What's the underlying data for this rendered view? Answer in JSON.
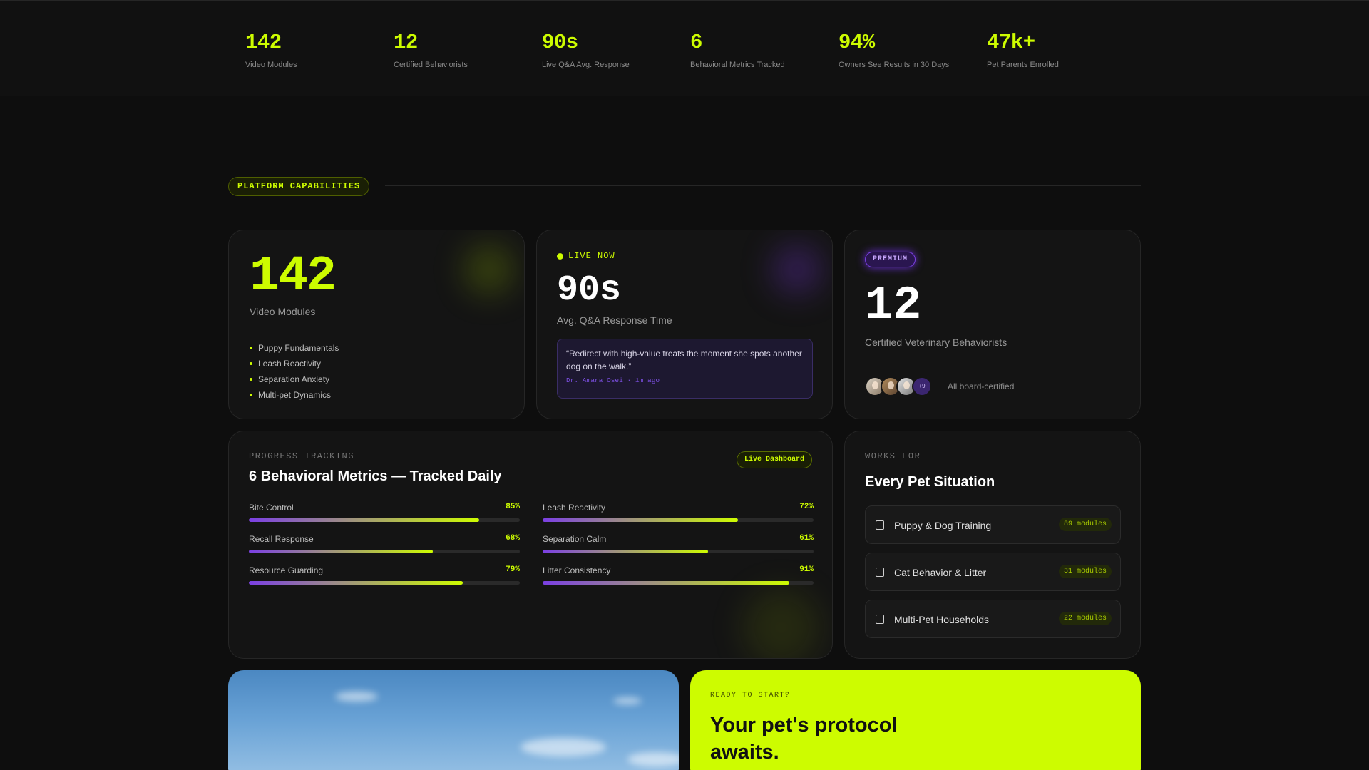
{
  "stats": [
    {
      "value": "142",
      "label": "Video Modules"
    },
    {
      "value": "12",
      "label": "Certified Behaviorists"
    },
    {
      "value": "90s",
      "label": "Live Q&A Avg. Response"
    },
    {
      "value": "6",
      "label": "Behavioral Metrics Tracked"
    },
    {
      "value": "94%",
      "label": "Owners See Results in 30 Days"
    },
    {
      "value": "47k+",
      "label": "Pet Parents Enrolled"
    }
  ],
  "section": {
    "tag": "PLATFORM CAPABILITIES"
  },
  "modules_card": {
    "number": "142",
    "label": "Video Modules",
    "items": [
      "Puppy Fundamentals",
      "Leash Reactivity",
      "Separation Anxiety",
      "Multi-pet Dynamics"
    ]
  },
  "qa_card": {
    "live": "LIVE NOW",
    "number": "90s",
    "label": "Avg. Q&A Response Time",
    "quote": "“Redirect with high-value treats the moment she spots another dog on the walk.”",
    "attribution": "Dr. Amara Osei · 1m ago"
  },
  "vets_card": {
    "badge": "PREMIUM",
    "number": "12",
    "label": "Certified Veterinary Behaviorists",
    "more_count": "+9",
    "note": "All board-certified"
  },
  "progress_card": {
    "kicker": "PROGRESS TRACKING",
    "title": "6 Behavioral Metrics — Tracked Daily",
    "badge": "Live Dashboard",
    "metrics": [
      {
        "name": "Bite Control",
        "pct_label": "85%",
        "value": 85
      },
      {
        "name": "Leash Reactivity",
        "pct_label": "72%",
        "value": 72
      },
      {
        "name": "Recall Response",
        "pct_label": "68%",
        "value": 68
      },
      {
        "name": "Separation Calm",
        "pct_label": "61%",
        "value": 61
      },
      {
        "name": "Resource Guarding",
        "pct_label": "79%",
        "value": 79
      },
      {
        "name": "Litter Consistency",
        "pct_label": "91%",
        "value": 91
      }
    ]
  },
  "works_card": {
    "kicker": "WORKS FOR",
    "title": "Every Pet Situation",
    "items": [
      {
        "name": "Puppy & Dog Training",
        "badge": "89 modules"
      },
      {
        "name": "Cat Behavior & Litter",
        "badge": "31 modules"
      },
      {
        "name": "Multi-Pet Households",
        "badge": "22 modules"
      }
    ]
  },
  "cta": {
    "kicker": "READY TO START?",
    "headline": "Your pet's protocol awaits."
  },
  "colors": {
    "accent": "#cdfc00",
    "purple": "#7b3fe4",
    "background": "#0e0e0e"
  }
}
